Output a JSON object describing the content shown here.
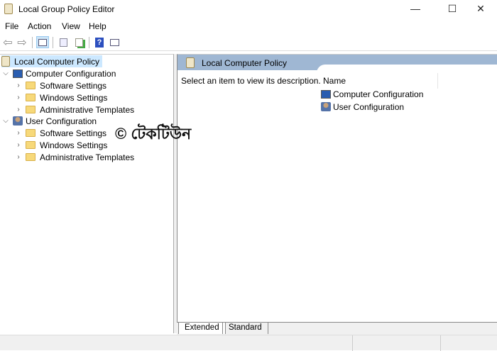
{
  "window": {
    "title": "Local Group Policy Editor",
    "minimize": "—",
    "maximize": "☐",
    "close": "✕"
  },
  "menu": [
    "File",
    "Action",
    "View",
    "Help"
  ],
  "toolbar": {
    "back": "⇦",
    "forward": "⇨",
    "help": "?"
  },
  "tree": {
    "root": "Local Computer Policy",
    "computer": {
      "label": "Computer Configuration",
      "children": [
        "Software Settings",
        "Windows Settings",
        "Administrative Templates"
      ]
    },
    "user": {
      "label": "User Configuration",
      "children": [
        "Software Settings",
        "Windows Settings",
        "Administrative Templates"
      ]
    }
  },
  "details": {
    "header": "Local Computer Policy",
    "description": "Select an item to view its description.",
    "column_name": "Name",
    "items": [
      "Computer Configuration",
      "User Configuration"
    ]
  },
  "tabs": [
    "Extended",
    "Standard"
  ],
  "watermark": "© টেকটিউন"
}
